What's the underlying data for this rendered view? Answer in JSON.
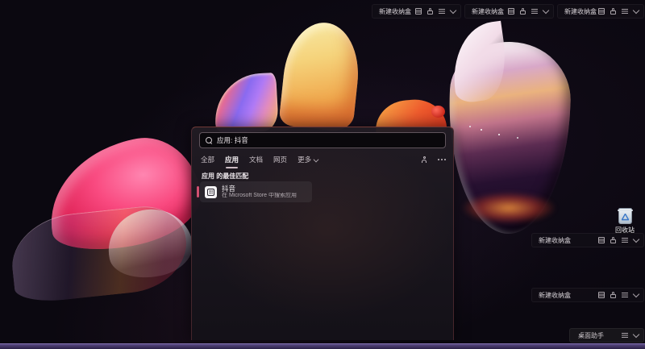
{
  "desktop": {
    "storage_boxes_top": [
      {
        "title": "新建收纳盒"
      },
      {
        "title": "新建收纳盒"
      },
      {
        "title": "新建收纳盒"
      }
    ],
    "storage_boxes_side": [
      {
        "title": "新建收纳盒"
      },
      {
        "title": "新建收纳盒"
      }
    ],
    "box_titlebar_icons": [
      "sort-icon",
      "lock-icon",
      "menu-icon",
      "chevron-down-icon"
    ],
    "recycle_bin": {
      "label": "回收站"
    },
    "assistant_bar": {
      "label": "桌面助手",
      "icons": [
        "menu-icon",
        "chevron-down-icon"
      ]
    }
  },
  "search_panel": {
    "search_box": {
      "value": "应用: 抖音",
      "icon": "search-icon"
    },
    "tabs": [
      {
        "label": "全部",
        "selected": false
      },
      {
        "label": "应用",
        "selected": true
      },
      {
        "label": "文档",
        "selected": false
      },
      {
        "label": "网页",
        "selected": false
      },
      {
        "label": "更多",
        "selected": false,
        "has_chevron": true
      }
    ],
    "toolbar_icons": [
      "user-icon",
      "more-options-icon"
    ],
    "section_header": "应用 的最佳匹配",
    "results": [
      {
        "title": "抖音",
        "subtitle": "在 Microsoft Store 中搜索应用",
        "icon": "store-app-icon"
      }
    ]
  },
  "colors": {
    "taskbar_purple": "#463869",
    "panel_border_red": "#8f4a48",
    "selection_accent_pink": "#d15070",
    "selected_tab_underline": "#cdbcc4",
    "recycle_glyph_blue": "#3a78c8"
  }
}
